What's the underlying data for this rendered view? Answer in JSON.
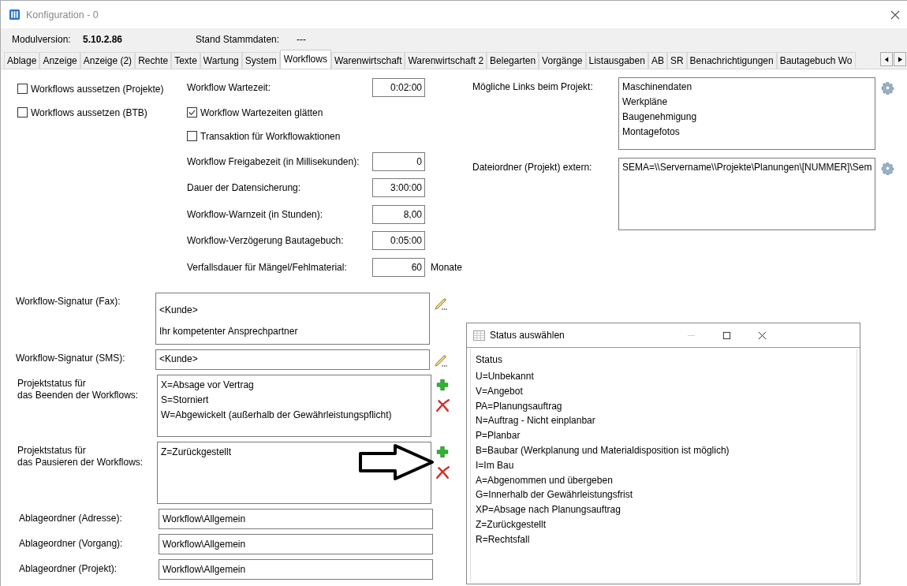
{
  "window": {
    "title": "Konfiguration - 0"
  },
  "info": [
    {
      "label": "Modulversion:",
      "value": "5.10.2.86"
    },
    {
      "label": "Stand Stammdaten:",
      "value": "---"
    }
  ],
  "tabs": [
    {
      "label": "Ablage",
      "selected": false
    },
    {
      "label": "Anzeige",
      "selected": false
    },
    {
      "label": "Anzeige (2)",
      "selected": false
    },
    {
      "label": "Rechte",
      "selected": false
    },
    {
      "label": "Texte",
      "selected": false
    },
    {
      "label": "Wartung",
      "selected": false
    },
    {
      "label": "System",
      "selected": false
    },
    {
      "label": "Workflows",
      "selected": true
    },
    {
      "label": "Warenwirtschaft",
      "selected": false
    },
    {
      "label": "Warenwirtschaft 2",
      "selected": false
    },
    {
      "label": "Belegarten",
      "selected": false
    },
    {
      "label": "Vorgänge",
      "selected": false
    },
    {
      "label": "Listausgaben",
      "selected": false
    },
    {
      "label": "AB",
      "selected": false
    },
    {
      "label": "SR",
      "selected": false
    },
    {
      "label": "Benachrichtigungen",
      "selected": false
    },
    {
      "label": "Bautagebuch Wo",
      "selected": false
    }
  ],
  "options": [
    {
      "label": "Workflows aussetzen (Projekte)",
      "checked": false
    },
    {
      "label": "Workflows aussetzen (BTB)",
      "checked": false
    }
  ],
  "settings": [
    {
      "kind": "field",
      "label": "Workflow Wartezeit:",
      "value": "0:02:00"
    },
    {
      "kind": "checkbox",
      "label": "Workflow Wartezeiten glätten",
      "checked": true
    },
    {
      "kind": "checkbox",
      "label": "Transaktion für Workflowaktionen",
      "checked": false
    },
    {
      "kind": "field",
      "label": "Workflow Freigabezeit (in Millisekunden):",
      "value": "0"
    },
    {
      "kind": "field",
      "label": "Dauer der Datensicherung:",
      "value": "3:00:00"
    },
    {
      "kind": "field",
      "label": "Workflow-Warnzeit (in Stunden):",
      "value": "8,00"
    },
    {
      "kind": "field",
      "label": "Workflow-Verzögerung Bautagebuch:",
      "value": "0:05:00"
    },
    {
      "kind": "field",
      "label": "Verfallsdauer für Mängel/Fehlmaterial:",
      "value": "60",
      "unit": "Monate"
    }
  ],
  "project_fields": [
    {
      "label": "Mögliche Links beim Projekt:",
      "lines": [
        "Maschinendaten",
        "Werkpläne",
        "Baugenehmigung",
        "Montagefotos"
      ]
    },
    {
      "label": "Dateiordner (Projekt) extern:",
      "lines": [
        "SEMA=\\\\Servername\\\\Projekte\\Planungen\\[NUMMER]\\Sem"
      ]
    }
  ],
  "text_fields": [
    {
      "kind": "signature",
      "label": "Workflow-Signatur (Fax):",
      "lines": [
        "<Kunde>",
        "Ihr kompetenter Ansprechpartner"
      ]
    },
    {
      "kind": "signature",
      "label": "Workflow-Signatur (SMS):",
      "lines": [
        "<Kunde>"
      ]
    },
    {
      "kind": "status",
      "label": "Projektstatus für\ndas Beenden der Workflows:",
      "lines": [
        "X=Absage vor Vertrag",
        "S=Storniert",
        "W=Abgewickelt (außerhalb der Gewährleistungspflicht)"
      ]
    },
    {
      "kind": "status",
      "label": "Projektstatus für\ndas Pausieren der Workflows:",
      "lines": [
        "Z=Zurückgestellt"
      ]
    },
    {
      "kind": "path",
      "label": "Ablageordner (Adresse):",
      "lines": [
        "Workflow\\Allgemein"
      ]
    },
    {
      "kind": "path",
      "label": "Ablageordner (Vorgang):",
      "lines": [
        "Workflow\\Allgemein"
      ]
    },
    {
      "kind": "path",
      "label": "Ablageordner (Projekt):",
      "lines": [
        "Workflow\\Allgemein"
      ]
    }
  ],
  "dialog": {
    "title": "Status auswählen",
    "header": "Status",
    "items": [
      "U=Unbekannt",
      "V=Angebot",
      "PA=Planungsauftrag",
      "N=Auftrag - Nicht einplanbar",
      "P=Planbar",
      "B=Baubar (Werkplanung und Materialdisposition ist möglich)",
      "I=Im Bau",
      "A=Abgenommen und übergeben",
      "G=Innerhalb der Gewährleistungsfrist",
      "XP=Absage nach Planungsauftrag",
      "Z=Zurückgestellt",
      "R=Rechtsfall"
    ]
  }
}
